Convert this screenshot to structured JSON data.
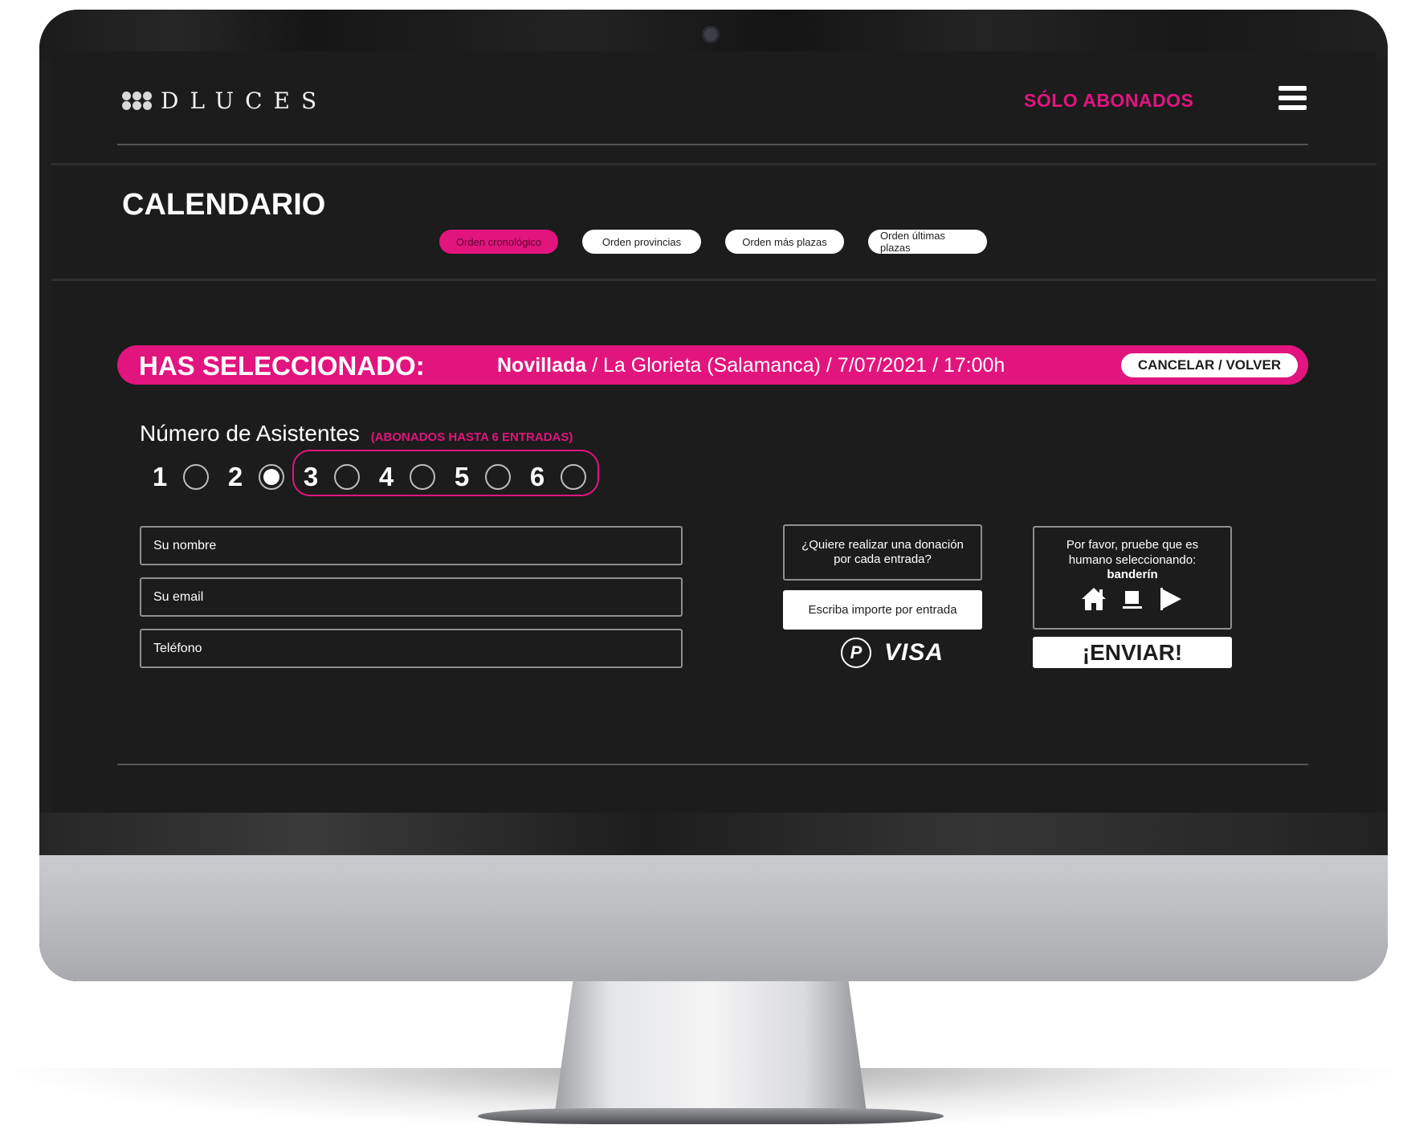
{
  "header": {
    "logo_text": "DLUCES",
    "members_link": "SÓLO ABONADOS",
    "menu_icon": "hamburger-menu-icon"
  },
  "page": {
    "title": "CALENDARIO",
    "tabs": [
      {
        "label": "Orden cronológico",
        "active": true
      },
      {
        "label": "Orden provincias",
        "active": false
      },
      {
        "label": "Orden más plazas",
        "active": false
      },
      {
        "label": "Orden últimas plazas",
        "active": false
      }
    ]
  },
  "selection": {
    "label": "HAS SELECCIONADO:",
    "event_type": "Novillada",
    "details": "/ La Glorieta (Salamanca) / 7/07/2021 / 17:00h",
    "cancel_label": "CANCELAR / VOLVER"
  },
  "attendees": {
    "title": "Número de Asistentes",
    "note": "(ABONADOS HASTA 6 ENTRADAS)",
    "options": [
      "1",
      "2",
      "3",
      "4",
      "5",
      "6"
    ],
    "selected": "2"
  },
  "form": {
    "name_placeholder": "Su nombre",
    "email_placeholder": "Su email",
    "phone_placeholder": "Teléfono"
  },
  "donation": {
    "question": "¿Quiere realizar una donación por cada entrada?",
    "amount_placeholder": "Escriba importe por entrada",
    "payment_methods": [
      "paypal-icon",
      "VISA"
    ],
    "visa_label": "VISA"
  },
  "captcha": {
    "prompt": "Por favor, pruebe que es humano seleccionando:",
    "target_word": "banderín",
    "icons": [
      "house-icon",
      "cup-icon",
      "flag-icon"
    ]
  },
  "submit": {
    "label": "¡ENVIAR!"
  },
  "colors": {
    "accent": "#e2147e",
    "background": "#1c1c1c",
    "text": "#ffffff"
  }
}
